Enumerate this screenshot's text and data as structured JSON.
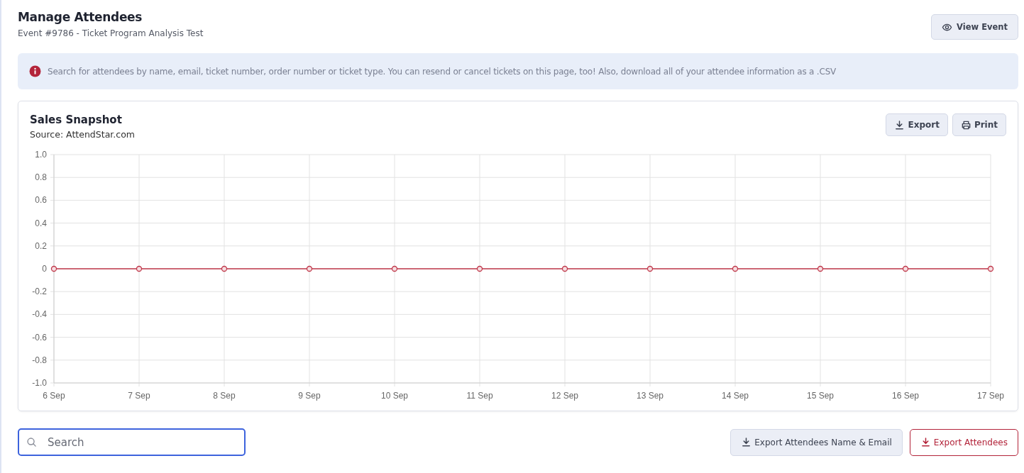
{
  "header": {
    "title": "Manage Attendees",
    "subtitle": "Event #9786 - Ticket Program Analysis Test",
    "view_button": "View Event"
  },
  "info_alert": {
    "text": "Search for attendees by name, email, ticket number, order number or ticket type. You can resend or cancel tickets on this page, too! Also, download all of your attendee information as a .CSV"
  },
  "sales_card": {
    "title": "Sales Snapshot",
    "source": "Source: AttendStar.com",
    "buttons": [
      {
        "label": "Export",
        "kind": "download"
      },
      {
        "label": "Print",
        "kind": "print"
      }
    ],
    "chart_data": {
      "type": "line",
      "categories": [
        "6 Sep",
        "7 Sep",
        "8 Sep",
        "9 Sep",
        "10 Sep",
        "11 Sep",
        "12 Sep",
        "13 Sep",
        "14 Sep",
        "15 Sep",
        "16 Sep",
        "17 Sep"
      ],
      "series": [
        {
          "color": "#c0394b",
          "marker": "circle",
          "values": [
            0,
            0,
            0,
            0,
            0,
            0,
            0,
            0,
            0,
            0,
            0,
            0
          ]
        }
      ],
      "grid": true,
      "ylim": [
        -1,
        1
      ],
      "yticks": [
        {
          "value": 1,
          "label": "1.0"
        },
        {
          "value": 0.8,
          "label": "0.8"
        },
        {
          "value": 0.6,
          "label": "0.6"
        },
        {
          "value": 0.4,
          "label": "0.4"
        },
        {
          "value": 0.2,
          "label": "0.2"
        },
        {
          "value": 0,
          "label": "0"
        },
        {
          "value": -0.2,
          "label": "-0.2"
        },
        {
          "value": -0.4,
          "label": "-0.4"
        },
        {
          "value": -0.6,
          "label": "-0.6"
        },
        {
          "value": -0.8,
          "label": "-0.8"
        },
        {
          "value": -1,
          "label": "-1.0"
        }
      ]
    }
  },
  "search": {
    "placeholder": "Search"
  },
  "export_buttons": [
    {
      "label": "Export Attendees Name & Email",
      "kind": "secondary"
    },
    {
      "label": "Export Attendees",
      "kind": "danger"
    }
  ]
}
